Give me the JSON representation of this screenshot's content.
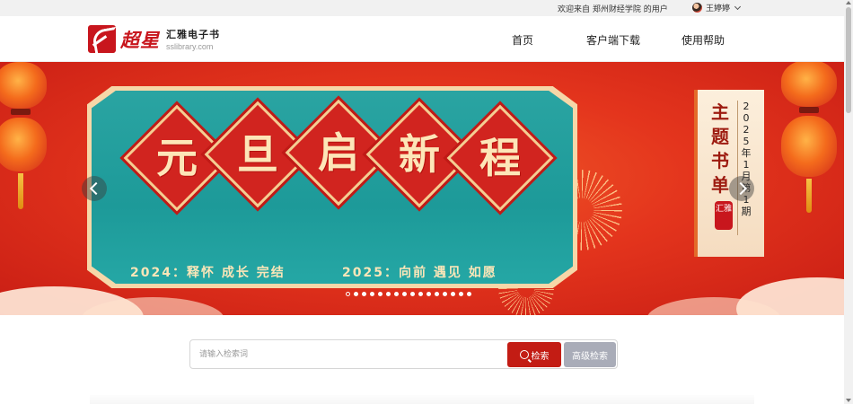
{
  "topbar": {
    "welcome": "欢迎来自 郑州财经学院 的用户",
    "username": "王婷婷"
  },
  "header": {
    "logo_chinese": "超星",
    "logo_title": "汇雅电子书",
    "logo_subtitle": "sslibrary.com",
    "nav": [
      {
        "label": "首页"
      },
      {
        "label": "客户端下载"
      },
      {
        "label": "使用帮助"
      }
    ]
  },
  "banner": {
    "headline_chars": [
      "元",
      "旦",
      "启",
      "新",
      "程"
    ],
    "subline_left": "2024：释怀 成长 完结",
    "subline_right": "2025：向前 遇见 如愿",
    "theme_title_chars": [
      "主",
      "题",
      "书",
      "单"
    ],
    "theme_date_chars": [
      "2",
      "0",
      "2",
      "5",
      "年",
      "1",
      "月",
      "第",
      "1",
      "期"
    ],
    "theme_seal": "汇雅",
    "slide_count": 16,
    "active_slide": 1,
    "colors": {
      "banner_red": "#e4351d",
      "panel_teal": "#1d9a99",
      "gold": "#fde6b8"
    }
  },
  "search": {
    "placeholder": "请输入检索词",
    "value": "",
    "search_label": "检索",
    "advanced_label": "高级检索"
  },
  "colors": {
    "brand_red": "#c31c14",
    "advanced_gray": "#a9acb8"
  }
}
